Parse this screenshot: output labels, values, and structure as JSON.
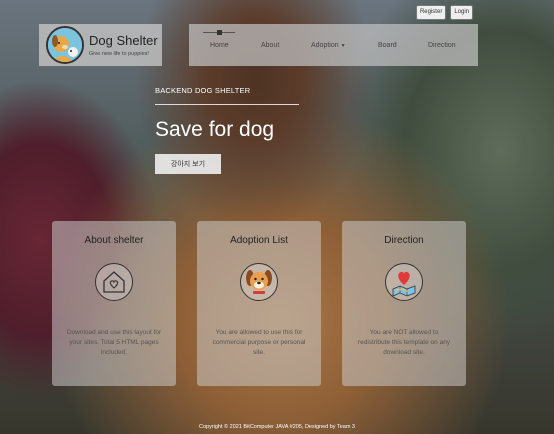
{
  "auth": {
    "register": "Register",
    "login": "Login"
  },
  "brand": {
    "title": "Dog Shelter",
    "subtitle": "Give new life to puppies!"
  },
  "nav": {
    "items": [
      "Home",
      "About",
      "Adoption",
      "Board",
      "Direction"
    ]
  },
  "hero": {
    "subtitle": "BACKEND DOG SHELTER",
    "title": "Save for dog",
    "button": "강아지 보기"
  },
  "cards": [
    {
      "title": "About shelter",
      "icon": "house-heart-icon",
      "text": "Download and use this layout for your sites. Total 5 HTML pages included."
    },
    {
      "title": "Adoption List",
      "icon": "dog-face-icon",
      "text": "You are allowed to use this for commercial purpose or personal site."
    },
    {
      "title": "Direction",
      "icon": "map-heart-icon",
      "text": "You are NOT allowed to redistribute this template on any download site."
    }
  ],
  "footer": {
    "text": "Copyright © 2021 BitComputer JAVA #205, Designed by Team 3"
  },
  "colors": {
    "card_bg": "#c8c8c8",
    "nav_bg": "#bebebe",
    "text_dark": "#222222"
  }
}
